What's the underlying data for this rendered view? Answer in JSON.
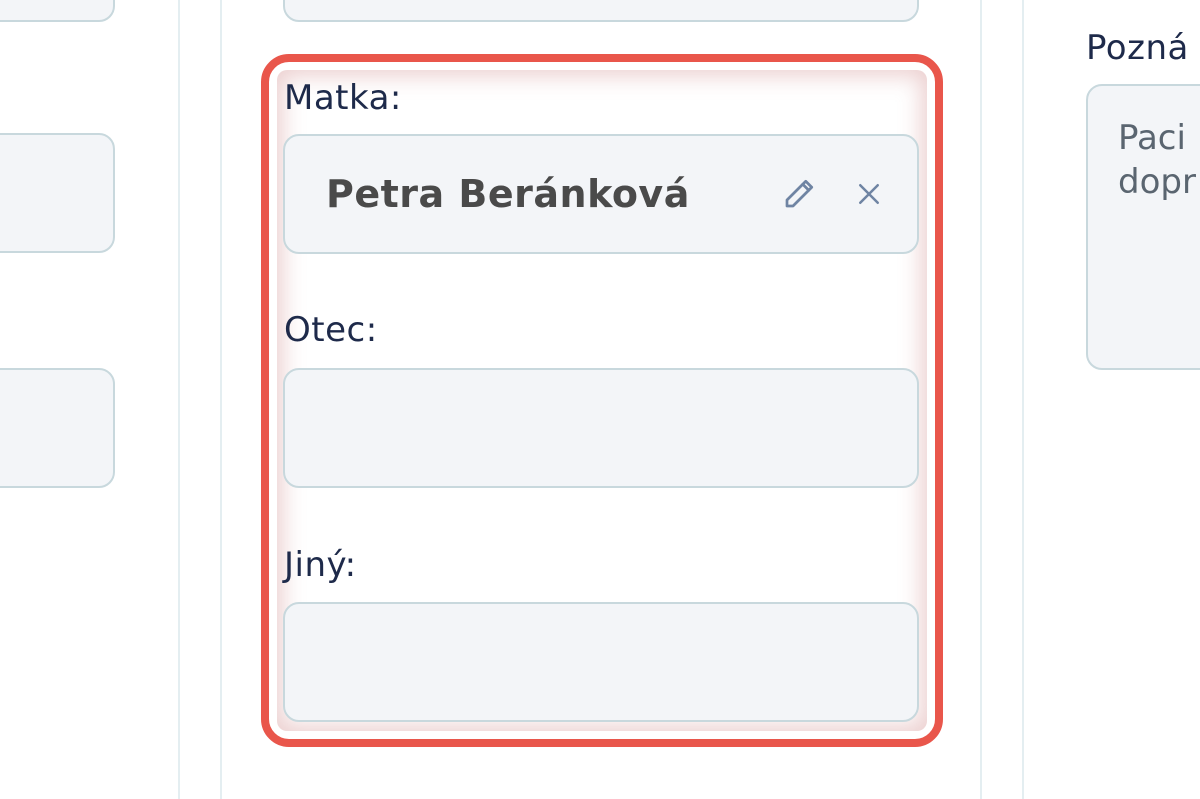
{
  "left_column": {},
  "middle_column": {
    "mother": {
      "label": "Matka:",
      "value": "Petra Beránková"
    },
    "father": {
      "label": "Otec:",
      "value": ""
    },
    "other": {
      "label": "Jiný:",
      "value": ""
    }
  },
  "right_column": {
    "notes": {
      "label": "Pozná",
      "text": "Paci\ndopr"
    }
  },
  "colors": {
    "highlight": "#e9564b",
    "field_bg": "#f3f5f8",
    "field_border": "#c8d8dd",
    "label": "#1e2a4a"
  },
  "icons": [
    "pencil-icon",
    "close-icon"
  ]
}
